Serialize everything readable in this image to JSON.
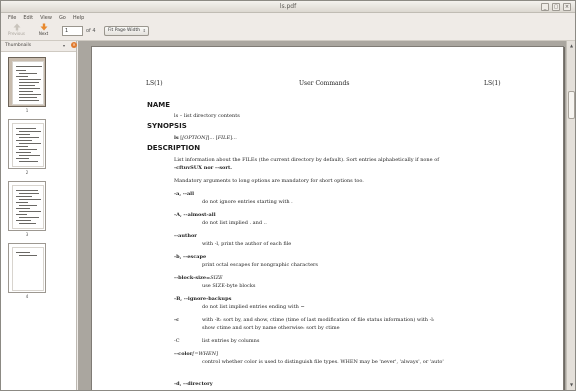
{
  "window": {
    "title": "ls.pdf",
    "buttons": [
      "_",
      "▢",
      "×"
    ]
  },
  "menu": [
    "File",
    "Edit",
    "View",
    "Go",
    "Help"
  ],
  "toolbar": {
    "previous_label": "Previous",
    "next_label": "Next",
    "page_value": "1",
    "page_of": "of 4",
    "zoom_value": "Fit Page Width"
  },
  "sidebar": {
    "select_label": "Thumbnails",
    "close_icon": "close-icon",
    "thumbnails": [
      {
        "label": "1"
      },
      {
        "label": "2"
      },
      {
        "label": "3"
      },
      {
        "label": "4"
      }
    ]
  },
  "document": {
    "header_left": "LS(1)",
    "header_center": "User Commands",
    "header_right": "LS(1)",
    "name_heading": "NAME",
    "name_text": "ls – list directory contents",
    "synopsis_heading": "SYNOPSIS",
    "synopsis_cmd": "ls",
    "synopsis_opt": "[OPTION]",
    "synopsis_mid": "... [",
    "synopsis_file": "FILE",
    "synopsis_end": "]...",
    "description_heading": "DESCRIPTION",
    "desc_line1": "List information about the FILEs (the current directory by default).  Sort entries alphabetically if none of",
    "desc_line2": "-cftuvSUX nor --sort.",
    "desc_line3": "Mandatory arguments to long options are mandatory for short options too.",
    "opt_all": "-a, --all",
    "opt_all_desc": "do not ignore entries starting with .",
    "opt_almost": "-A, --almost-all",
    "opt_almost_desc": "do not list implied . and ..",
    "opt_author": "--author",
    "opt_author_desc": "with -l, print the author of each file",
    "opt_escape": "-b, --escape",
    "opt_escape_desc": "print octal escapes for nongraphic characters",
    "opt_block": "--block-size=",
    "opt_block_arg": "SIZE",
    "opt_block_desc": "use SIZE-byte blocks",
    "opt_ignore": "-B, --ignore-backups",
    "opt_ignore_desc": "do not list implied entries ending with ~",
    "opt_c": "-c",
    "opt_c_desc1": "with -lt: sort by, and show, ctime (time of last modification of file status information) with -l:",
    "opt_c_desc2": "show ctime and sort by name otherwise: sort by ctime",
    "opt_C": "-C",
    "opt_C_desc": "list entries by columns",
    "opt_color": "--color",
    "opt_color_arg": "[=WHEN]",
    "opt_color_desc": "control whether color is used to distinguish file types.  WHEN may be 'never', 'always', or 'auto'",
    "opt_directory": "-d, --directory"
  }
}
